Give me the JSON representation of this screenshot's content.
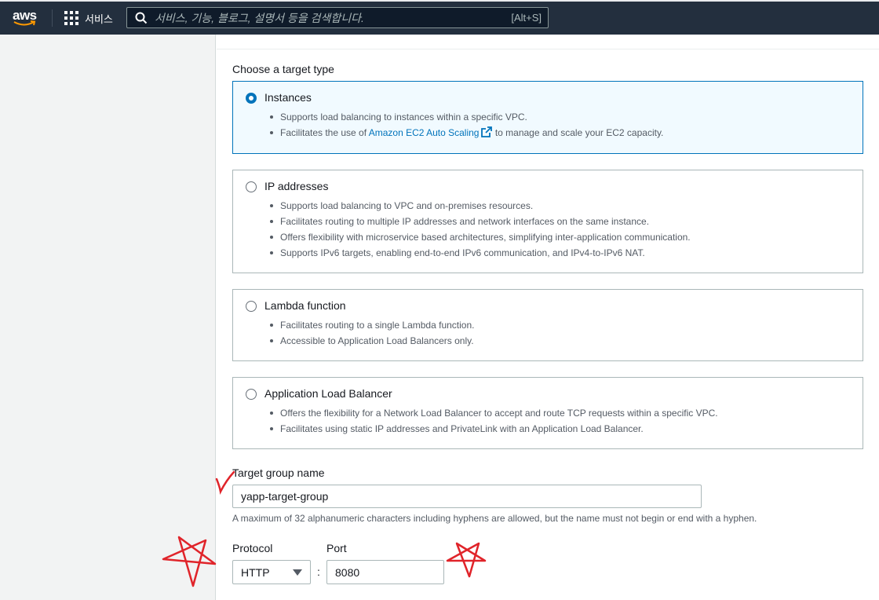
{
  "topbar": {
    "logo_text": "aws",
    "services_label": "서비스",
    "search_placeholder": "서비스, 기능, 블로그, 설명서 등을 검색합니다.",
    "search_shortcut": "[Alt+S]"
  },
  "target_type": {
    "heading": "Choose a target type",
    "options": [
      {
        "label": "Instances",
        "selected": true,
        "bullets": [
          "Supports load balancing to instances within a specific VPC.",
          {
            "prefix": "Facilitates the use of ",
            "link": "Amazon EC2 Auto Scaling",
            "suffix": " to manage and scale your EC2 capacity."
          }
        ]
      },
      {
        "label": "IP addresses",
        "selected": false,
        "bullets": [
          "Supports load balancing to VPC and on-premises resources.",
          "Facilitates routing to multiple IP addresses and network interfaces on the same instance.",
          "Offers flexibility with microservice based architectures, simplifying inter-application communication.",
          "Supports IPv6 targets, enabling end-to-end IPv6 communication, and IPv4-to-IPv6 NAT."
        ]
      },
      {
        "label": "Lambda function",
        "selected": false,
        "bullets": [
          "Facilitates routing to a single Lambda function.",
          "Accessible to Application Load Balancers only."
        ]
      },
      {
        "label": "Application Load Balancer",
        "selected": false,
        "bullets": [
          "Offers the flexibility for a Network Load Balancer to accept and route TCP requests within a specific VPC.",
          "Facilitates using static IP addresses and PrivateLink with an Application Load Balancer."
        ]
      }
    ]
  },
  "target_group_name": {
    "label": "Target group name",
    "value": "yapp-target-group",
    "hint": "A maximum of 32 alphanumeric characters including hyphens are allowed, but the name must not begin or end with a hyphen."
  },
  "protocol": {
    "label": "Protocol",
    "value": "HTTP"
  },
  "port": {
    "label": "Port",
    "separator": ":",
    "value": "8080"
  },
  "colors": {
    "nav_bg": "#232f3e",
    "accent": "#0073bb",
    "selected_tile_bg": "#f1faff",
    "annotation_red": "#e0242a"
  }
}
